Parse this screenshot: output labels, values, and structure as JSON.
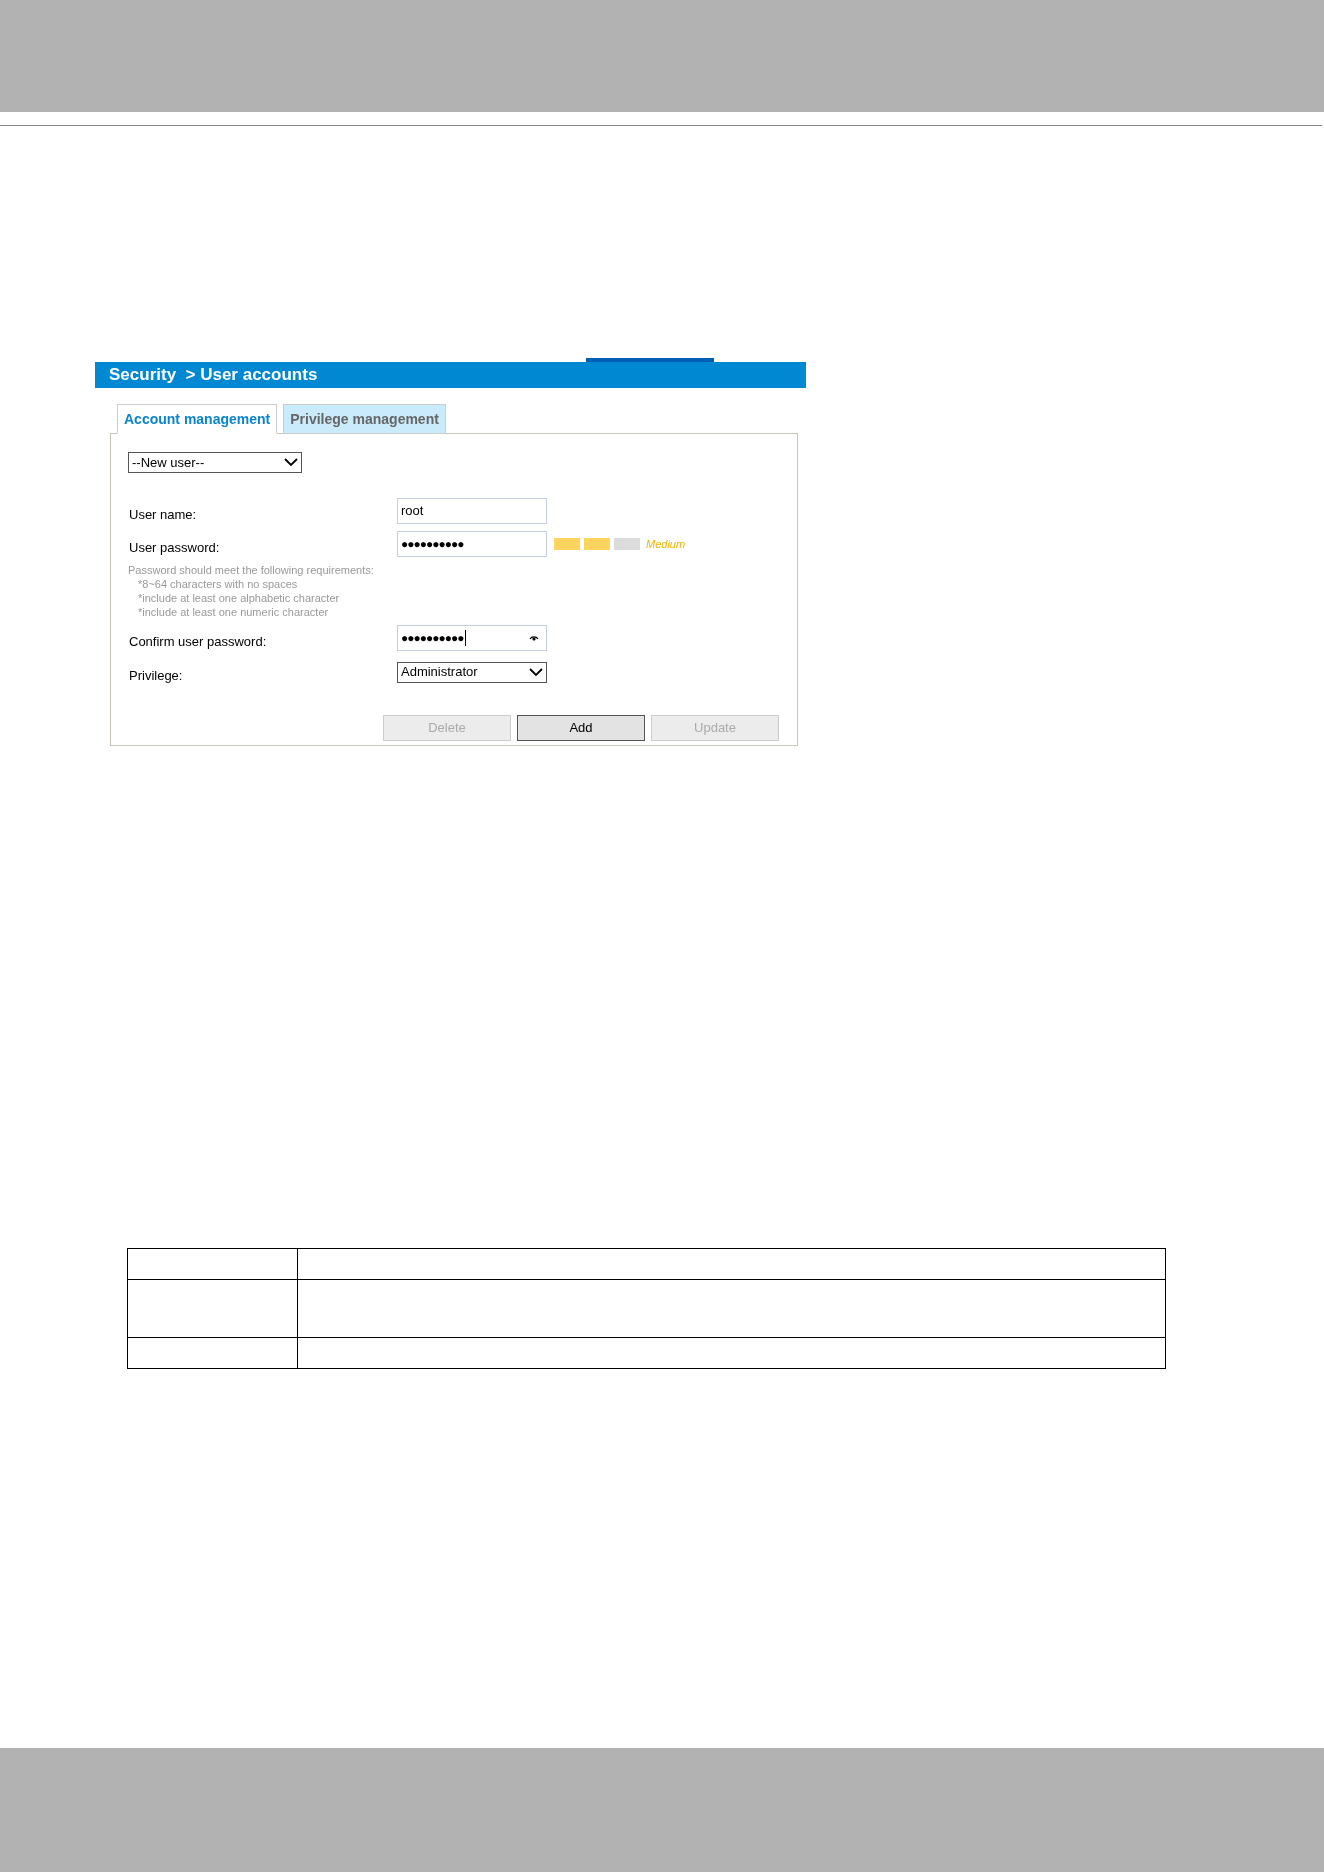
{
  "breadcrumb": "Security  > User accounts",
  "tabs": [
    {
      "label": "Account management",
      "selected": true
    },
    {
      "label": "Privilege management",
      "selected": false
    }
  ],
  "user_select": {
    "value": "--New user--"
  },
  "fields": [
    {
      "kind": "text",
      "label": "User name:",
      "value": "root"
    },
    {
      "kind": "password",
      "label": "User password:",
      "value": "●●●●●●●●●●",
      "strength": {
        "level": 0.67,
        "reading": "Medium"
      }
    },
    {
      "kind": "hint",
      "lines": [
        "Password should meet the following requirements:",
        "*8~64 characters with no spaces",
        "*include at least one alphabetic character",
        "*include at least one numeric character"
      ]
    },
    {
      "kind": "password",
      "label": "Confirm user password:",
      "value": "●●●●●●●●●●",
      "reveal": true
    },
    {
      "kind": "select",
      "label": "Privilege:",
      "value": "Administrator"
    }
  ],
  "buttons": [
    {
      "label": "Delete",
      "disabled": true
    },
    {
      "label": "Add",
      "disabled": false
    },
    {
      "label": "Update",
      "disabled": true
    }
  ]
}
